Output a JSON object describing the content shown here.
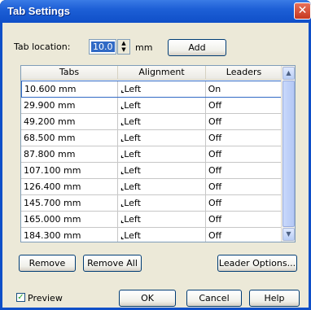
{
  "window": {
    "title": "Tab Settings",
    "close_glyph": "✕"
  },
  "tab_location": {
    "label": "Tab location:",
    "value": "10.0",
    "unit": "mm",
    "add_label": "Add"
  },
  "table": {
    "headers": [
      "Tabs",
      "Alignment",
      "Leaders"
    ],
    "rows": [
      {
        "tab": "10.600 mm",
        "align": "Left",
        "leader": "On"
      },
      {
        "tab": "29.900 mm",
        "align": "Left",
        "leader": "Off"
      },
      {
        "tab": "49.200 mm",
        "align": "Left",
        "leader": "Off"
      },
      {
        "tab": "68.500 mm",
        "align": "Left",
        "leader": "Off"
      },
      {
        "tab": "87.800 mm",
        "align": "Left",
        "leader": "Off"
      },
      {
        "tab": "107.100 mm",
        "align": "Left",
        "leader": "Off"
      },
      {
        "tab": "126.400 mm",
        "align": "Left",
        "leader": "Off"
      },
      {
        "tab": "145.700 mm",
        "align": "Left",
        "leader": "Off"
      },
      {
        "tab": "165.000 mm",
        "align": "Left",
        "leader": "Off"
      },
      {
        "tab": "184.300 mm",
        "align": "Left",
        "leader": "Off"
      }
    ]
  },
  "buttons": {
    "remove": "Remove",
    "remove_all": "Remove All",
    "leader_options": "Leader Options...",
    "ok": "OK",
    "cancel": "Cancel",
    "help": "Help"
  },
  "preview": {
    "label": "Preview",
    "checked": true
  }
}
